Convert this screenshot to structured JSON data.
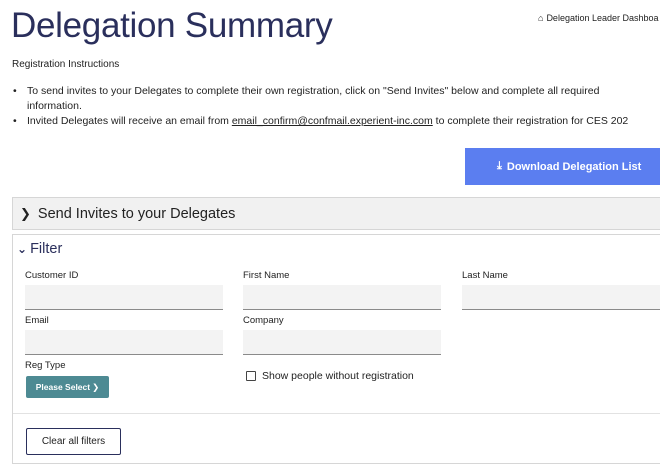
{
  "page": {
    "title": "Delegation Summary",
    "breadcrumb": "Delegation Leader Dashboa",
    "breadcrumb_icon": "home-icon"
  },
  "instructions": {
    "heading": "Registration Instructions",
    "item1": "To send invites to your Delegates to complete their own registration, click on \"Send Invites\" below and complete all required information.",
    "item2_prefix": "Invited Delegates will receive an email from ",
    "item2_email": "email_confirm@confmail.experient-inc.com",
    "item2_suffix": " to complete their registration for CES 202"
  },
  "buttons": {
    "download": "Download Delegation List",
    "clear_filters": "Clear all filters",
    "please_select": "Please Select"
  },
  "sections": {
    "send_invites": "Send Invites to your Delegates",
    "filter": "Filter"
  },
  "filter": {
    "customer_id_label": "Customer ID",
    "first_name_label": "First Name",
    "last_name_label": "Last Name",
    "email_label": "Email",
    "company_label": "Company",
    "reg_type_label": "Reg Type",
    "show_without_reg": "Show people without registration",
    "customer_id_value": "",
    "first_name_value": "",
    "last_name_value": "",
    "email_value": "",
    "company_value": "",
    "show_without_reg_checked": false
  },
  "colors": {
    "title": "#2a2f5c",
    "download_button": "#5b7ef0",
    "select_button": "#4d8a93"
  }
}
